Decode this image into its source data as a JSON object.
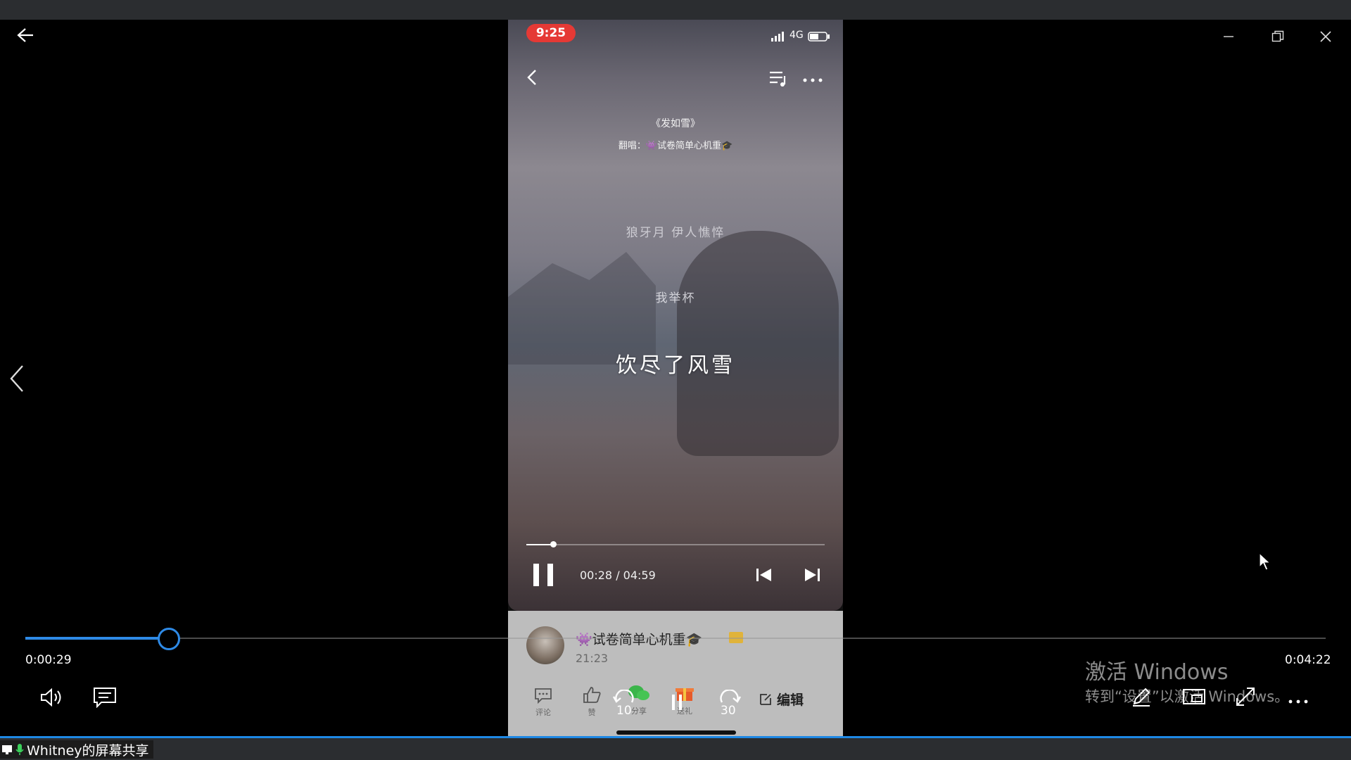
{
  "status": {
    "time": "9:25",
    "network": "4G"
  },
  "song": {
    "title": "《发如雪》",
    "cover": "翻唱：👾试卷简单心机重🎓"
  },
  "lyrics": {
    "line1": "狼牙月 伊人憔悴",
    "line2": "我举杯",
    "line3": "饮尽了风雪"
  },
  "phone_player": {
    "time": "00:28 / 04:59",
    "progress": 0.09
  },
  "uploader": {
    "name": "👾试卷简单心机重🎓",
    "time": "21:23"
  },
  "actions": {
    "comment": "评论",
    "like": "赞",
    "share": "分享",
    "gift": "送礼",
    "edit": "编辑",
    "rewind": "10",
    "forward": "30"
  },
  "outer_player": {
    "current": "0:00:29",
    "total": "0:04:22",
    "progress": 0.11
  },
  "watermark": {
    "line1": "激活 Windows",
    "line2": "转到“设置”以激活 Windows。"
  },
  "screen_share": {
    "label": "Whitney的屏幕共享"
  },
  "colors": {
    "accent": "#1e88e5",
    "time_pill": "#e53935"
  }
}
